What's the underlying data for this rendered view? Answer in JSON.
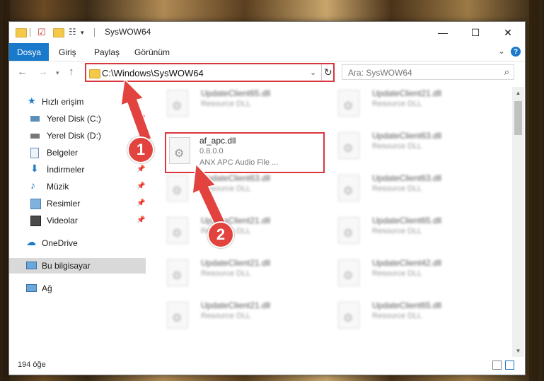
{
  "window": {
    "title": "SysWOW64",
    "controls": {
      "minimize": "—",
      "maximize": "☐",
      "close": "✕"
    }
  },
  "ribbon": {
    "tabs": [
      "Dosya",
      "Giriş",
      "Paylaş",
      "Görünüm"
    ],
    "help": "?"
  },
  "address": {
    "path": "C:\\Windows\\SysWOW64",
    "search_placeholder": "Ara: SysWOW64"
  },
  "sidebar": {
    "items": [
      {
        "label": "Hızlı erişim",
        "icon": "star-icon"
      },
      {
        "label": "Yerel Disk (C:)",
        "icon": "drive-icon"
      },
      {
        "label": "Yerel Disk (D:)",
        "icon": "drive-icon"
      },
      {
        "label": "Belgeler",
        "icon": "documents-icon"
      },
      {
        "label": "İndirmeler",
        "icon": "download-icon"
      },
      {
        "label": "Müzik",
        "icon": "music-icon"
      },
      {
        "label": "Resimler",
        "icon": "pictures-icon"
      },
      {
        "label": "Videolar",
        "icon": "video-icon"
      },
      {
        "label": "OneDrive",
        "icon": "cloud-icon"
      },
      {
        "label": "Bu bilgisayar",
        "icon": "computer-icon"
      },
      {
        "label": "Ağ",
        "icon": "network-icon"
      }
    ]
  },
  "files": {
    "selected": {
      "name": "af_apc.dll",
      "version": "0.8.0.0",
      "description": "ANX APC Audio File ..."
    },
    "others": [
      {
        "name": "UpdateClient65.dll",
        "type": "Resource DLL"
      },
      {
        "name": "UpdateClient21.dll",
        "type": "Resource DLL"
      },
      {
        "name": "UpdateClient63.dll",
        "type": "Resource DLL"
      },
      {
        "name": "UpdateClient63.dll",
        "type": "Resource DLL"
      },
      {
        "name": "UpdateClient63.dll",
        "type": "Resource DLL"
      },
      {
        "name": "UpdateClient21.dll",
        "type": "Resource DLL"
      },
      {
        "name": "UpdateClient65.dll",
        "type": "Resource DLL"
      },
      {
        "name": "UpdateClient21.dll",
        "type": "Resource DLL"
      },
      {
        "name": "UpdateClient42.dll",
        "type": "Resource DLL"
      },
      {
        "name": "UpdateClient21.dll",
        "type": "Resource DLL"
      },
      {
        "name": "UpdateClient65.dll",
        "type": "Resource DLL"
      }
    ]
  },
  "status": {
    "count": "194 öğe"
  },
  "annotations": {
    "step1": "1",
    "step2": "2"
  },
  "colors": {
    "accent": "#1979ca",
    "highlight": "#d9363e"
  }
}
